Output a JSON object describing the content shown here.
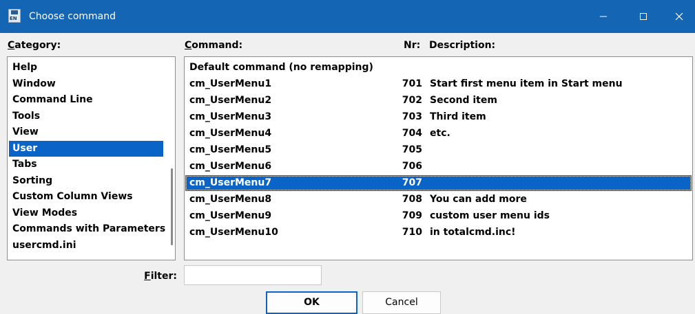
{
  "window": {
    "title": "Choose command",
    "icon": "totalcmd-disk-icon",
    "controls": {
      "minimize": "minimize-icon",
      "maximize": "maximize-icon",
      "close": "close-icon"
    }
  },
  "headers": {
    "category_ul": "C",
    "category_rest": "ategory:",
    "command_ul": "C",
    "command_rest": "ommand:",
    "nr": "Nr:",
    "description": "Description:"
  },
  "categories": {
    "selected": "User",
    "items": [
      "Help",
      "Window",
      "Command Line",
      "Tools",
      "View",
      "User",
      "Tabs",
      "Sorting",
      "Custom Column Views",
      "View Modes",
      "Commands with Parameters",
      "usercmd.ini"
    ]
  },
  "commands": {
    "selected": "cm_UserMenu7",
    "rows": [
      {
        "command": "Default command (no remapping)",
        "nr": "",
        "description": ""
      },
      {
        "command": "cm_UserMenu1",
        "nr": "701",
        "description": "Start first menu item in Start menu"
      },
      {
        "command": "cm_UserMenu2",
        "nr": "702",
        "description": "Second item"
      },
      {
        "command": "cm_UserMenu3",
        "nr": "703",
        "description": "Third item"
      },
      {
        "command": "cm_UserMenu4",
        "nr": "704",
        "description": "etc."
      },
      {
        "command": "cm_UserMenu5",
        "nr": "705",
        "description": ""
      },
      {
        "command": "cm_UserMenu6",
        "nr": "706",
        "description": ""
      },
      {
        "command": "cm_UserMenu7",
        "nr": "707",
        "description": ""
      },
      {
        "command": "cm_UserMenu8",
        "nr": "708",
        "description": "You can add more"
      },
      {
        "command": "cm_UserMenu9",
        "nr": "709",
        "description": "custom user menu ids"
      },
      {
        "command": "cm_UserMenu10",
        "nr": "710",
        "description": "in totalcmd.inc!"
      }
    ]
  },
  "filter": {
    "label_ul": "F",
    "label_rest": "ilter:",
    "value": ""
  },
  "buttons": {
    "ok": "OK",
    "cancel": "Cancel"
  },
  "colors": {
    "titlebar": "#1565b5",
    "selection": "#0a64c8",
    "dialog_bg": "#f0f0f0"
  }
}
